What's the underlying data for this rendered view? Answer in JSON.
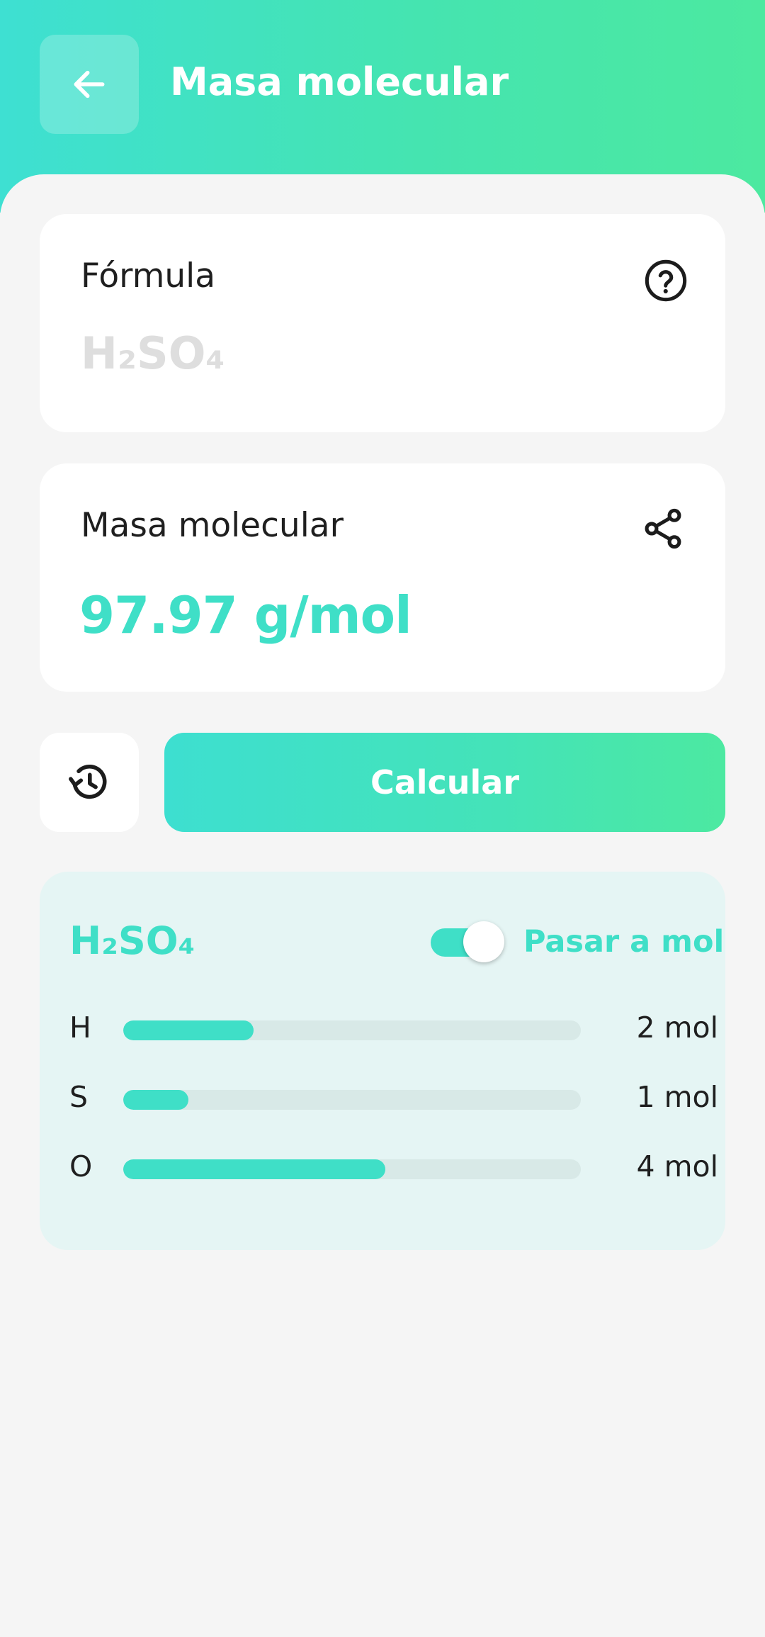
{
  "header": {
    "title": "Masa molecular",
    "background_gradient": [
      "#3ee0d2",
      "#4ce9a0"
    ],
    "back_icon": "arrow-left-icon"
  },
  "formula_card": {
    "label": "Fórmula",
    "placeholder": "H₂SO₄",
    "value": "",
    "help_icon": "help-circle-icon"
  },
  "mass_card": {
    "label": "Masa molecular",
    "value": "97.97 g/mol",
    "share_icon": "share-icon"
  },
  "actions": {
    "history_icon": "history-icon",
    "calculate_label": "Calcular"
  },
  "result": {
    "formula": "H₂SO₄",
    "toggle_label": "Pasar a mol",
    "toggle_on": true,
    "elements": [
      {
        "symbol": "H",
        "count": "2 mol",
        "fraction": 0.285
      },
      {
        "symbol": "S",
        "count": "1 mol",
        "fraction": 0.143
      },
      {
        "symbol": "O",
        "count": "4 mol",
        "fraction": 0.572
      }
    ]
  },
  "colors": {
    "accent": "#3fdfc7",
    "panel_bg": "#e5f5f4",
    "page_bg": "#f5f5f5"
  }
}
